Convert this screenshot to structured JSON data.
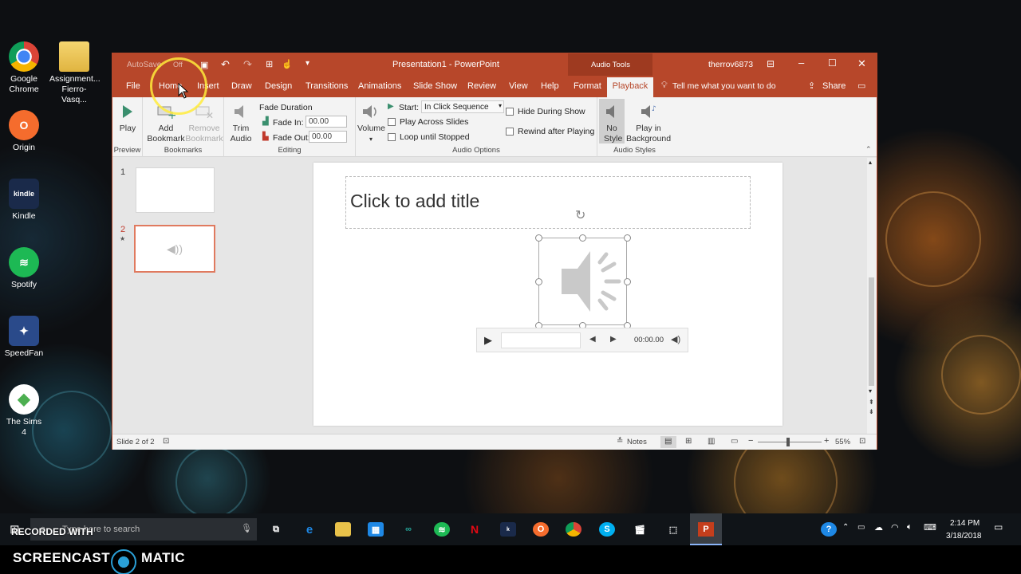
{
  "desktop": {
    "icons": [
      {
        "label": "Google Chrome",
        "icon": "chrome-icon",
        "color": "#db4437"
      },
      {
        "label": "Assignment... Fierro-Vasq...",
        "icon": "folder-icon",
        "color": "#e8c24a"
      },
      {
        "label": "Origin",
        "icon": "origin-icon",
        "color": "#f56c2d"
      },
      {
        "label": "Kindle",
        "icon": "kindle-icon",
        "color": "#1a2a4a"
      },
      {
        "label": "Spotify",
        "icon": "spotify-icon",
        "color": "#1db954"
      },
      {
        "label": "SpeedFan",
        "icon": "speedfan-icon",
        "color": "#2a4a8a"
      },
      {
        "label": "The Sims 4",
        "icon": "sims-icon",
        "color": "#4caf50"
      }
    ]
  },
  "window": {
    "title": "Presentation1 - PowerPoint",
    "autosave_label": "AutoSave",
    "autosave_state": "Off",
    "context_label": "Audio Tools",
    "user": "therrov6873",
    "controls": [
      "minimize",
      "maximize",
      "close"
    ],
    "accent_color": "#b7472a"
  },
  "ribbon_tabs": [
    "File",
    "Home",
    "Insert",
    "Draw",
    "Design",
    "Transitions",
    "Animations",
    "Slide Show",
    "Review",
    "View",
    "Help",
    "Format",
    "Playback"
  ],
  "active_tab": "Playback",
  "tell_me": "Tell me what you want to do",
  "share": "Share",
  "ribbon": {
    "preview": {
      "play": "Play",
      "group": "Preview"
    },
    "bookmarks": {
      "add": "Add Bookmark",
      "remove": "Remove Bookmark",
      "group": "Bookmarks"
    },
    "editing": {
      "trim": "Trim Audio",
      "fade_duration": "Fade Duration",
      "fade_in_label": "Fade In:",
      "fade_in_value": "00.00",
      "fade_out_label": "Fade Out:",
      "fade_out_value": "00.00",
      "group": "Editing"
    },
    "audio_options": {
      "volume": "Volume",
      "start_label": "Start:",
      "start_value": "In Click Sequence",
      "play_across": "Play Across Slides",
      "loop": "Loop until Stopped",
      "hide": "Hide During Show",
      "rewind": "Rewind after Playing",
      "group": "Audio Options"
    },
    "audio_styles": {
      "no_style": "No Style",
      "play_bg": "Play in Background",
      "group": "Audio Styles"
    }
  },
  "slides": [
    {
      "num": "1",
      "star": ""
    },
    {
      "num": "2",
      "star": "★"
    }
  ],
  "slide": {
    "title_placeholder": "Click to add title",
    "player_time": "00:00.00"
  },
  "status": {
    "slide_info": "Slide 2 of 2",
    "notes": "Notes",
    "zoom": "55%",
    "zoom_level": 0.55
  },
  "taskbar": {
    "search_placeholder": "Type here to search",
    "time": "2:14 PM",
    "date": "3/18/2018"
  },
  "watermark": {
    "line1": "RECORDED WITH",
    "line2a": "SCREENCAST",
    "line2b": "MATIC"
  }
}
